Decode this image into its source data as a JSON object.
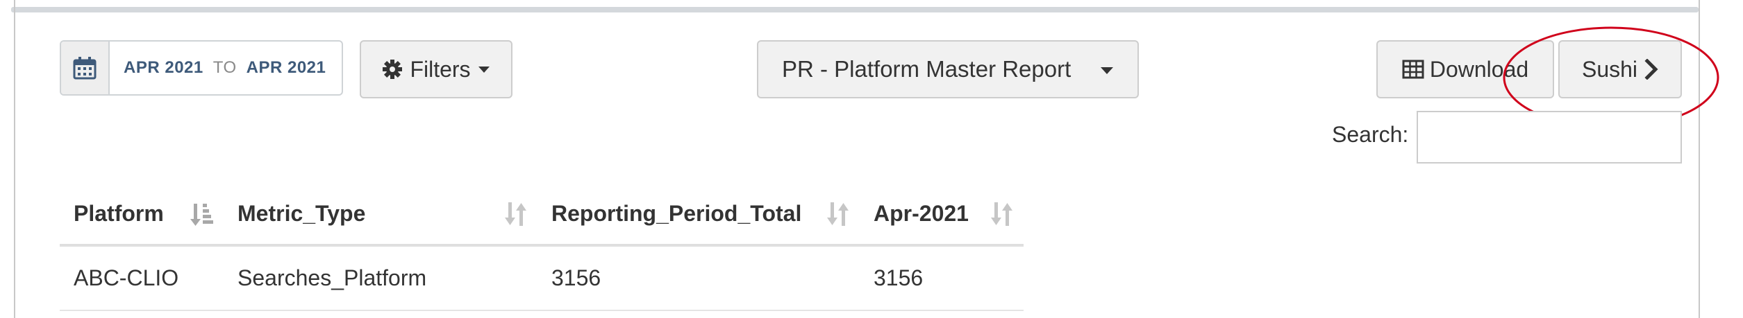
{
  "date_range": {
    "start": "APR 2021",
    "separator": "TO",
    "end": "APR 2021"
  },
  "toolbar": {
    "filters_label": "Filters",
    "report_selected": "PR - Platform Master Report",
    "download_label": "Download",
    "sushi_label": "Sushi"
  },
  "search": {
    "label": "Search:",
    "value": ""
  },
  "table": {
    "columns": [
      "Platform",
      "Metric_Type",
      "Reporting_Period_Total",
      "Apr-2021"
    ],
    "rows": [
      [
        "ABC-CLIO",
        "Searches_Platform",
        "3156",
        "3156"
      ]
    ]
  },
  "icons": {
    "calendar": "calendar-icon",
    "filters": "gear-icon",
    "filters_caret": "caret-down-icon",
    "report_caret": "caret-down-icon",
    "download": "table-icon",
    "sushi": "chevron-right-icon",
    "sort_active": "sort-alpha-down-icon",
    "sort": "sort-icon"
  },
  "colors": {
    "date_text": "#3e5a7a",
    "annotation": "#d0021b",
    "button_bg": "#f1f1f1",
    "sort_icon": "#b5b5b5"
  }
}
